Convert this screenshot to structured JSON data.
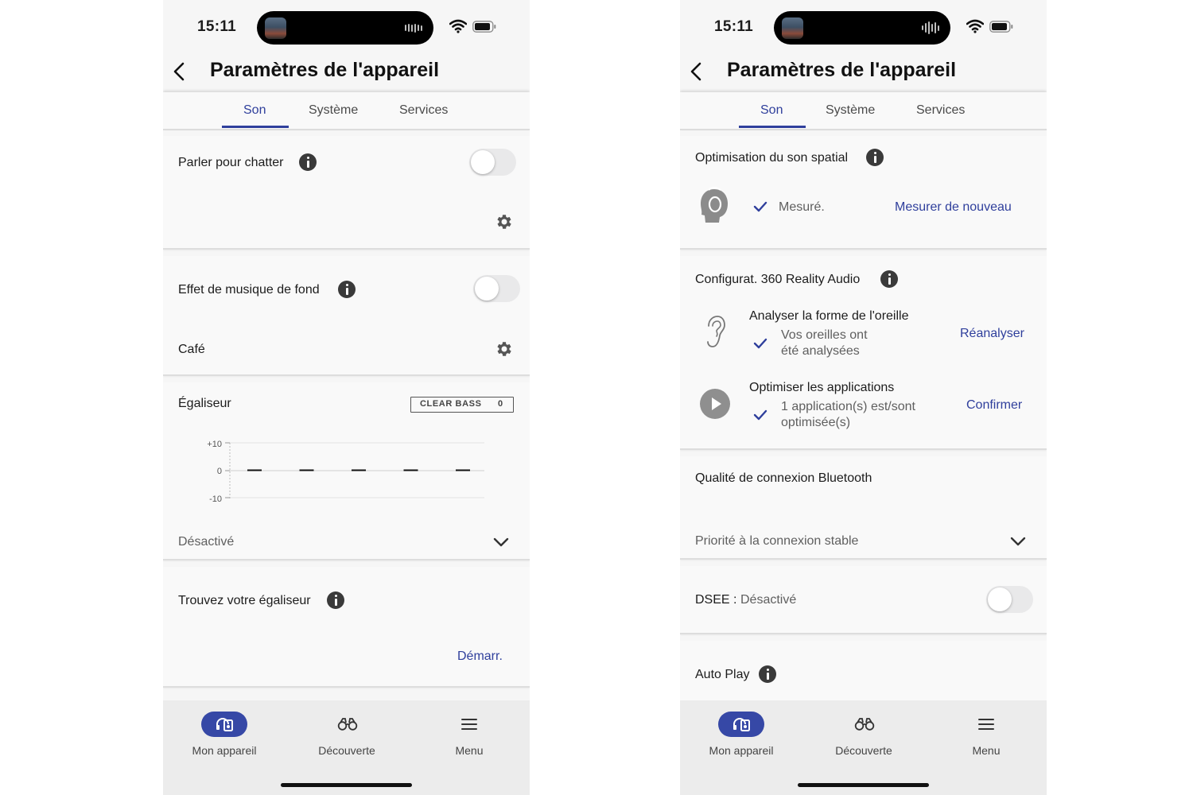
{
  "status": {
    "time": "15:11"
  },
  "header": {
    "title": "Paramètres de l'appareil"
  },
  "tabs": [
    {
      "label": "Son",
      "active": true
    },
    {
      "label": "Système",
      "active": false
    },
    {
      "label": "Services",
      "active": false
    }
  ],
  "left": {
    "speak_to_chat": {
      "label": "Parler pour chatter",
      "enabled": false
    },
    "bg_music": {
      "label": "Effet de musique de fond",
      "enabled": false,
      "mode": "Café"
    },
    "equalizer": {
      "label": "Égaliseur",
      "clear_bass_label": "CLEAR BASS",
      "clear_bass_value": "0",
      "y_ticks": [
        "+10",
        "0",
        "-10"
      ],
      "band_values": [
        0,
        0,
        0,
        0,
        0
      ],
      "preset": "Désactivé"
    },
    "find_eq": {
      "label": "Trouvez votre égaliseur",
      "action": "Démarr."
    }
  },
  "right": {
    "spatial": {
      "label": "Optimisation du son spatial",
      "status": "Mesuré.",
      "action": "Mesurer de nouveau"
    },
    "reality360": {
      "label": "Configurat. 360 Reality Audio",
      "ear_title": "Analyser la forme de l'oreille",
      "ear_status_1": "Vos oreilles ont",
      "ear_status_2": "été analysées",
      "ear_action": "Réanalyser",
      "apps_title": "Optimiser les applications",
      "apps_status_1": "1 application(s) est/sont",
      "apps_status_2": "optimisée(s)",
      "apps_action": "Confirmer"
    },
    "bluetooth": {
      "label": "Qualité de connexion Bluetooth",
      "value": "Priorité à la connexion stable"
    },
    "dsee": {
      "label": "DSEE :",
      "value": "Désactivé",
      "enabled": false
    },
    "autoplay": {
      "label": "Auto Play"
    }
  },
  "nav": [
    {
      "label": "Mon appareil",
      "icon": "headphones-device-icon",
      "active": true
    },
    {
      "label": "Découverte",
      "icon": "binoculars-icon",
      "active": false
    },
    {
      "label": "Menu",
      "icon": "hamburger-menu-icon",
      "active": false
    }
  ],
  "colors": {
    "accent": "#2f3f9c",
    "nav_active": "#3648a6",
    "background": "#f6f6f6"
  }
}
